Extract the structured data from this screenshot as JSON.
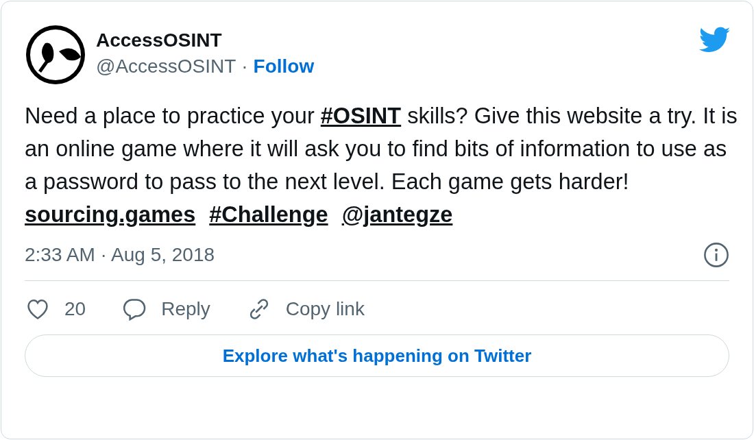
{
  "author": {
    "name": "AccessOSINT",
    "handle": "@AccessOSINT",
    "separator": "·",
    "follow": "Follow"
  },
  "body": [
    {
      "kind": "text",
      "text": "Need a place to practice your "
    },
    {
      "kind": "link",
      "text": "#OSINT"
    },
    {
      "kind": "text",
      "text": " skills? Give this website a try. It is an online game where it will ask you to find bits of information to use as a password to pass to the next level. Each game gets harder!"
    }
  ],
  "links": [
    "sourcing.games",
    "#Challenge",
    "@jantegze"
  ],
  "timestamp": "2:33 AM · Aug 5, 2018",
  "actions": [
    {
      "kind": "like",
      "label": "20"
    },
    {
      "kind": "reply",
      "label": "Reply"
    },
    {
      "kind": "copy",
      "label": "Copy link"
    }
  ],
  "explore_button": "Explore what's happening on Twitter"
}
